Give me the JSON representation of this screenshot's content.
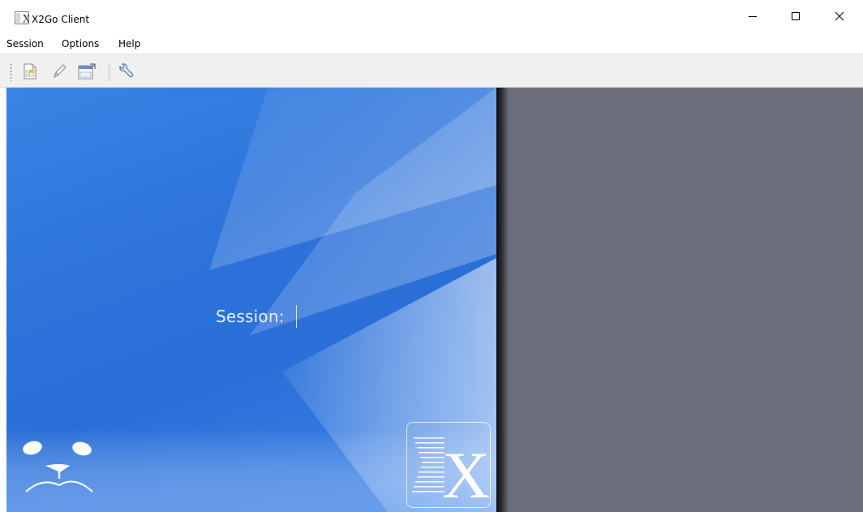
{
  "window": {
    "title": "X2Go Client",
    "icons": {
      "app": "x2go-app-icon",
      "minimize": "minimize-icon",
      "maximize": "maximize-icon",
      "close": "close-icon"
    }
  },
  "menubar": {
    "items": [
      {
        "label": "Session"
      },
      {
        "label": "Options"
      },
      {
        "label": "Help"
      }
    ]
  },
  "toolbar": {
    "tools": [
      {
        "icon": "new-session-icon"
      },
      {
        "icon": "edit-session-icon"
      },
      {
        "icon": "session-shortcut-icon"
      },
      {
        "icon": "settings-wrench-icon"
      }
    ]
  },
  "main": {
    "session_label": "Session:",
    "session_value": "",
    "logo_letter": "X"
  },
  "colors": {
    "left_pane_blue": "#2e74db",
    "right_pane_gray": "#6c6e7b",
    "toolbar_bg": "#f0f0f0"
  }
}
